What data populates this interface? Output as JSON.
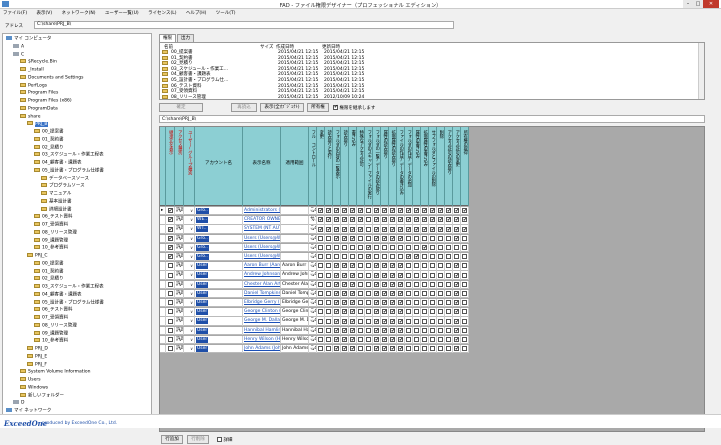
{
  "window": {
    "title": "FAD - ファイル権限デザイナー（プロフェッショナル エディション）",
    "min": "–",
    "max": "□",
    "close": "✕"
  },
  "menu": [
    "ファイル(F)",
    "表示(V)",
    "ネットワーク(N)",
    "ユーザー一覧(U)",
    "ライセンス(L)",
    "ヘルプ(H)",
    "ツール(T)"
  ],
  "address": {
    "label": "アドレス",
    "value": "C:\\share\\PRJ_B\\"
  },
  "tree": [
    {
      "label": "マイ コンピュータ",
      "lv": 0,
      "icon": "pc"
    },
    {
      "label": "A",
      "lv": 1,
      "icon": "drv"
    },
    {
      "label": "C",
      "lv": 1,
      "icon": "drv"
    },
    {
      "label": "$Recycle.Bin",
      "lv": 2,
      "icon": "fold"
    },
    {
      "label": "_Install",
      "lv": 2,
      "icon": "fold"
    },
    {
      "label": "Documents and Settings",
      "lv": 2,
      "icon": "fold"
    },
    {
      "label": "PerfLogs",
      "lv": 2,
      "icon": "fold"
    },
    {
      "label": "Program Files",
      "lv": 2,
      "icon": "fold"
    },
    {
      "label": "Program Files (x86)",
      "lv": 2,
      "icon": "fold"
    },
    {
      "label": "ProgramData",
      "lv": 2,
      "icon": "fold"
    },
    {
      "label": "share",
      "lv": 2,
      "icon": "fold"
    },
    {
      "label": "PRJ_B",
      "lv": 3,
      "icon": "fold",
      "sel": true
    },
    {
      "label": "00_提案書",
      "lv": 4,
      "icon": "fold"
    },
    {
      "label": "01_契約書",
      "lv": 4,
      "icon": "fold"
    },
    {
      "label": "02_見積り",
      "lv": 4,
      "icon": "fold"
    },
    {
      "label": "03_スケジュール・作業工程表",
      "lv": 4,
      "icon": "fold"
    },
    {
      "label": "04_顧客書・課題表",
      "lv": 4,
      "icon": "fold"
    },
    {
      "label": "05_設計書・プログラム仕様書",
      "lv": 4,
      "icon": "fold"
    },
    {
      "label": "データベースソース",
      "lv": 5,
      "icon": "fold"
    },
    {
      "label": "プログラムソース",
      "lv": 5,
      "icon": "fold"
    },
    {
      "label": "マニュアル",
      "lv": 5,
      "icon": "fold"
    },
    {
      "label": "基本設計書",
      "lv": 5,
      "icon": "fold"
    },
    {
      "label": "詳細設計書",
      "lv": 5,
      "icon": "fold"
    },
    {
      "label": "06_テスト資料",
      "lv": 4,
      "icon": "fold"
    },
    {
      "label": "07_受領資料",
      "lv": 4,
      "icon": "fold"
    },
    {
      "label": "08_リリース管理",
      "lv": 4,
      "icon": "fold"
    },
    {
      "label": "09_課題管理",
      "lv": 4,
      "icon": "fold"
    },
    {
      "label": "10_参考資料",
      "lv": 4,
      "icon": "fold"
    },
    {
      "label": "PRJ_C",
      "lv": 3,
      "icon": "fold"
    },
    {
      "label": "00_提案書",
      "lv": 4,
      "icon": "fold"
    },
    {
      "label": "01_契約書",
      "lv": 4,
      "icon": "fold"
    },
    {
      "label": "02_見積り",
      "lv": 4,
      "icon": "fold"
    },
    {
      "label": "03_スケジュール・作業工程表",
      "lv": 4,
      "icon": "fold"
    },
    {
      "label": "04_顧客書・課題表",
      "lv": 4,
      "icon": "fold"
    },
    {
      "label": "05_設計書・プログラム仕様書",
      "lv": 4,
      "icon": "fold"
    },
    {
      "label": "06_テスト資料",
      "lv": 4,
      "icon": "fold"
    },
    {
      "label": "07_受領資料",
      "lv": 4,
      "icon": "fold"
    },
    {
      "label": "08_リリース管理",
      "lv": 4,
      "icon": "fold"
    },
    {
      "label": "09_課題管理",
      "lv": 4,
      "icon": "fold"
    },
    {
      "label": "10_参考資料",
      "lv": 4,
      "icon": "fold"
    },
    {
      "label": "PRJ_D",
      "lv": 3,
      "icon": "fold"
    },
    {
      "label": "PRJ_E",
      "lv": 3,
      "icon": "fold"
    },
    {
      "label": "PRJ_F",
      "lv": 3,
      "icon": "fold"
    },
    {
      "label": "System Volume Information",
      "lv": 2,
      "icon": "fold"
    },
    {
      "label": "Users",
      "lv": 2,
      "icon": "fold"
    },
    {
      "label": "Windows",
      "lv": 2,
      "icon": "fold"
    },
    {
      "label": "新しいフォルダー",
      "lv": 2,
      "icon": "fold"
    },
    {
      "label": "D",
      "lv": 1,
      "icon": "drv"
    },
    {
      "label": "マイ ネットワーク",
      "lv": 0,
      "icon": "pc"
    }
  ],
  "tabs": [
    "権限",
    "出力"
  ],
  "filelist": {
    "headers": {
      "name": "名前",
      "size": "サイズ",
      "created": "作成日時",
      "modified": "更新日時"
    },
    "rows": [
      [
        "00_提案書",
        "",
        "2015/04/21 12:15",
        "2015/04/21 12:15"
      ],
      [
        "01_契約書",
        "",
        "2015/04/21 12:15",
        "2015/04/21 12:15"
      ],
      [
        "02_見積り",
        "",
        "2015/04/21 12:15",
        "2015/04/21 12:15"
      ],
      [
        "03_スケジュール・作業工…",
        "",
        "2015/04/21 12:15",
        "2015/04/21 12:15"
      ],
      [
        "04_顧客書・課題表",
        "",
        "2015/04/21 12:15",
        "2015/04/21 12:15"
      ],
      [
        "05_設計書・プログラム仕…",
        "",
        "2015/04/21 12:15",
        "2015/04/21 12:15"
      ],
      [
        "06_テスト資料",
        "",
        "2015/04/21 12:15",
        "2015/04/21 12:15"
      ],
      [
        "07_受領資料",
        "",
        "2015/04/21 12:15",
        "2015/04/21 12:15"
      ],
      [
        "08_リリース管理",
        "",
        "2015/04/21 12:15",
        "2012/10/09 10:24"
      ]
    ]
  },
  "buttons": {
    "confirm": "確定",
    "cancel": "再読込",
    "display": "表示(全ｵﾌﾞｼﾞｪｸﾄ)",
    "owner": "所有権",
    "show_inherited": "権限を継承します",
    "add_row": "行追加",
    "del_row": "行削除",
    "detail": "詳細"
  },
  "path": "C:\\share\\PRJ_B\\",
  "grid": {
    "col_headers": [
      "継承元を表示",
      "アクセス種別",
      "ユーザー/グループ種別",
      "アカウント名",
      "表示名称",
      "適用範囲",
      "フル コントロール",
      "変更",
      "読み取りと実行",
      "フォルダの内容の一覧表示",
      "読み取り",
      "書き込み",
      "特殊なアクセス許可",
      "フォルダのスキャン/ファイルの実行",
      "フォルダの一覧/データの読み取り",
      "属性の読み取り",
      "拡張属性の読み取り",
      "ファイルの作成/データの書き込み",
      "フォルダの作成/データの追加",
      "属性の書き込み",
      "拡張属性の書き込み",
      "サブフォルダとファイルの削除",
      "削除",
      "アクセス許可の読み取り",
      "アクセス許可の変更",
      "所有権の取得"
    ],
    "rows": [
      {
        "inh": true,
        "acc": "許可",
        "type": "Gro..",
        "acct": "Administrators (Administr...",
        "disp": "",
        "scope": "このフォルダ、サブフ...",
        "p": [
          1,
          1,
          1,
          1,
          1,
          1,
          0,
          1,
          1,
          1,
          1,
          1,
          1,
          1,
          1,
          1,
          1,
          1,
          1,
          1
        ]
      },
      {
        "inh": true,
        "acc": "許可",
        "type": "WE..",
        "acct": "CREATOR OWNER",
        "disp": "",
        "scope": "サブフォルダとファイ...",
        "p": [
          1,
          1,
          1,
          1,
          1,
          1,
          0,
          1,
          1,
          1,
          1,
          1,
          1,
          1,
          1,
          1,
          1,
          1,
          1,
          1
        ]
      },
      {
        "inh": true,
        "acc": "許可",
        "type": "WT..",
        "acct": "SYSTEM (NT AUTHORITY...",
        "disp": "",
        "scope": "このフォルダ、サブフ...",
        "p": [
          1,
          1,
          1,
          1,
          1,
          1,
          0,
          1,
          1,
          1,
          1,
          1,
          1,
          1,
          1,
          1,
          1,
          1,
          1,
          1
        ]
      },
      {
        "inh": true,
        "acc": "許可",
        "type": "Gro..",
        "acct": "Users (Users@WIN2012STD)",
        "disp": "",
        "scope": "このフォルダ、サブフ...",
        "p": [
          0,
          0,
          1,
          1,
          1,
          0,
          0,
          1,
          1,
          1,
          1,
          0,
          0,
          0,
          0,
          0,
          0,
          1,
          0,
          0
        ]
      },
      {
        "inh": true,
        "acc": "許可",
        "type": "Gro..",
        "acct": "Users (Users@WIN2012STD)",
        "disp": "",
        "scope": "このフォルダ、サブフ...",
        "p": [
          0,
          0,
          0,
          0,
          0,
          0,
          1,
          0,
          0,
          0,
          0,
          0,
          0,
          1,
          0,
          0,
          0,
          0,
          0,
          0
        ]
      },
      {
        "inh": true,
        "acc": "許可",
        "type": "Gro..",
        "acct": "Users (Users@WIN2012STD)",
        "disp": "",
        "scope": "このフォルダのみ",
        "p": [
          0,
          0,
          0,
          0,
          0,
          0,
          1,
          0,
          0,
          0,
          0,
          1,
          1,
          0,
          0,
          0,
          0,
          0,
          0,
          0
        ]
      },
      {
        "inh": false,
        "acc": "許可",
        "type": "User",
        "acct": "Aaron Burr (Aaron Burr@...",
        "disp": "Aaron Burr",
        "scope": "このフォルダ、サブフ...",
        "p": [
          0,
          0,
          1,
          1,
          1,
          0,
          0,
          1,
          1,
          1,
          1,
          0,
          0,
          0,
          0,
          0,
          0,
          1,
          0,
          0
        ]
      },
      {
        "inh": false,
        "acc": "許可",
        "type": "User",
        "acct": "Andrew Johnson (Andrew ...",
        "disp": "Andrew Johnson",
        "scope": "このフォルダ、サブフ...",
        "p": [
          0,
          0,
          1,
          1,
          1,
          0,
          0,
          1,
          1,
          1,
          1,
          0,
          0,
          0,
          0,
          0,
          0,
          1,
          0,
          0
        ]
      },
      {
        "inh": false,
        "acc": "許可",
        "type": "User",
        "acct": "Chester Alan Arthur (Ches...",
        "disp": "Chester Alan Arthur",
        "scope": "このフォルダ、サブフ...",
        "p": [
          0,
          0,
          1,
          1,
          1,
          0,
          0,
          1,
          1,
          1,
          1,
          0,
          0,
          0,
          0,
          0,
          0,
          1,
          0,
          0
        ]
      },
      {
        "inh": false,
        "acc": "許可",
        "type": "User",
        "acct": "Daniel Tompkins (Daniel ...",
        "disp": "Daniel Tompkins",
        "scope": "このフォルダ、サブフ...",
        "p": [
          0,
          0,
          1,
          1,
          1,
          0,
          0,
          1,
          1,
          1,
          1,
          0,
          0,
          0,
          0,
          0,
          0,
          1,
          0,
          0
        ]
      },
      {
        "inh": false,
        "acc": "許可",
        "type": "User",
        "acct": "Elbridge Gerry (Elbridge G...",
        "disp": "Elbridge Gerry",
        "scope": "このフォルダ、サブフ...",
        "p": [
          0,
          0,
          1,
          1,
          1,
          0,
          0,
          1,
          1,
          1,
          1,
          0,
          0,
          0,
          0,
          0,
          0,
          1,
          0,
          0
        ]
      },
      {
        "inh": false,
        "acc": "許可",
        "type": "User",
        "acct": "George Clinton (George Cl...",
        "disp": "George Clinton",
        "scope": "このフォルダ、サブフ...",
        "p": [
          0,
          0,
          1,
          1,
          1,
          0,
          0,
          1,
          1,
          1,
          1,
          0,
          0,
          0,
          0,
          0,
          0,
          1,
          0,
          0
        ]
      },
      {
        "inh": false,
        "acc": "許可",
        "type": "User",
        "acct": "George M. Dallas (George ...",
        "disp": "George M. Dallas",
        "scope": "このフォルダ、サブフ...",
        "p": [
          0,
          0,
          1,
          1,
          1,
          0,
          0,
          1,
          1,
          1,
          1,
          0,
          0,
          0,
          0,
          0,
          0,
          1,
          0,
          0
        ]
      },
      {
        "inh": false,
        "acc": "許可",
        "type": "User",
        "acct": "Hannibal Hamlin (Hannibal...",
        "disp": "Hannibal Hamlin",
        "scope": "このフォルダ、サブフ...",
        "p": [
          0,
          0,
          1,
          1,
          1,
          0,
          0,
          1,
          1,
          1,
          1,
          0,
          0,
          0,
          0,
          0,
          0,
          1,
          0,
          0
        ]
      },
      {
        "inh": false,
        "acc": "許可",
        "type": "User",
        "acct": "Henry Wilson (Henry Wils...",
        "disp": "Henry Wilson",
        "scope": "このフォルダ、サブフ...",
        "p": [
          0,
          0,
          1,
          1,
          1,
          0,
          0,
          1,
          1,
          1,
          1,
          0,
          0,
          0,
          0,
          0,
          0,
          1,
          0,
          0
        ]
      },
      {
        "inh": false,
        "acc": "許可",
        "type": "User",
        "acct": "John Adams (John Adam...",
        "disp": "John Adams",
        "scope": "このフォルダ、サブフ...",
        "p": [
          0,
          0,
          1,
          1,
          1,
          0,
          0,
          1,
          1,
          1,
          1,
          0,
          0,
          0,
          0,
          0,
          0,
          1,
          0,
          0
        ]
      }
    ]
  },
  "footer": {
    "logo": "ExceedOne",
    "produced": "produced by ExceedOne Co., Ltd."
  },
  "colors": {
    "header_teal": "#8ccfd3",
    "link": "#1a4fb8",
    "type_badge": "#1f4fa8",
    "selection": "#3a73c6"
  }
}
